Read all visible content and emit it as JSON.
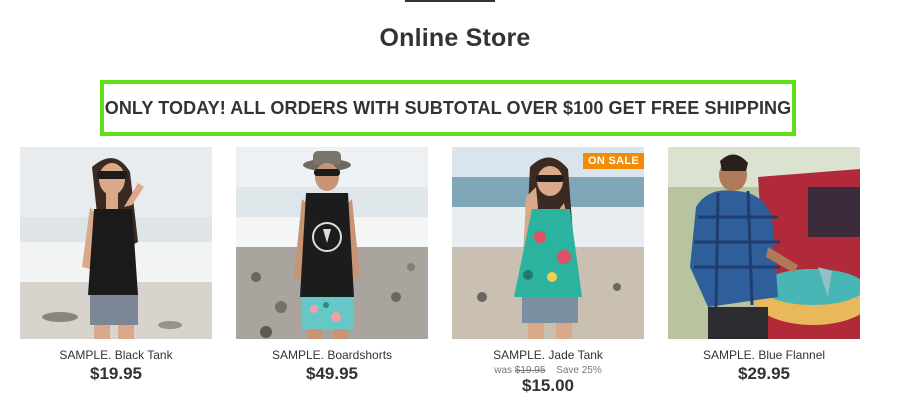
{
  "store": {
    "title": "Online Store",
    "banner": "ONLY TODAY! ALL ORDERS WITH SUBTOTAL OVER $100 GET FREE SHIPPING"
  },
  "products": [
    {
      "name": "SAMPLE. Black Tank",
      "price": "$19.95"
    },
    {
      "name": "SAMPLE. Boardshorts",
      "price": "$49.95"
    },
    {
      "name": "SAMPLE. Jade Tank",
      "badge": "ON SALE",
      "was_label": "was",
      "was_price": "$19.95",
      "save": "Save 25%",
      "price": "$15.00"
    },
    {
      "name": "SAMPLE. Blue Flannel",
      "price": "$29.95"
    }
  ],
  "colors": {
    "banner_border": "#5ee014",
    "sale_badge": "#f28b06",
    "text": "#333333"
  }
}
